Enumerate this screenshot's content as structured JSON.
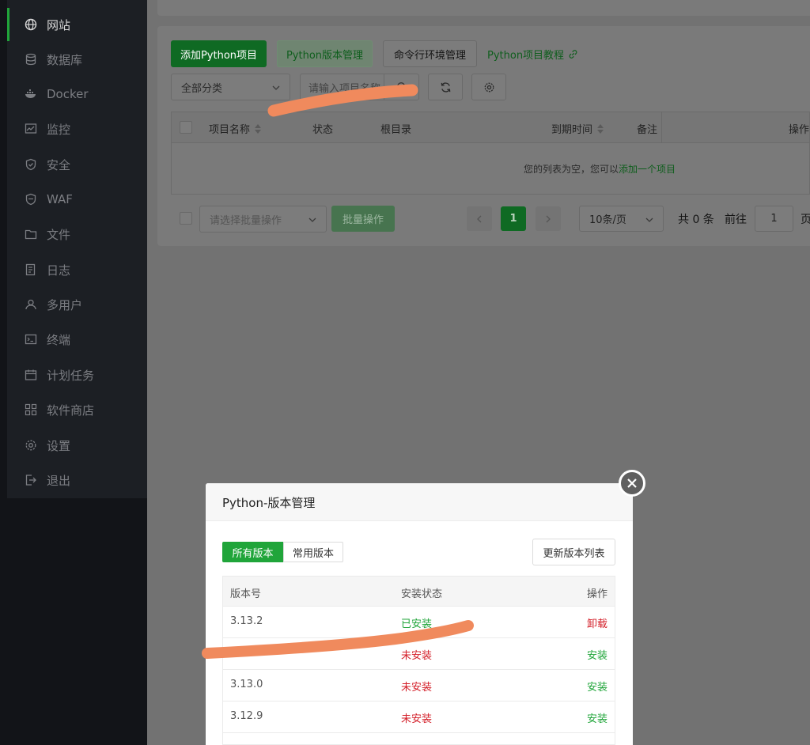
{
  "sidebar": {
    "items": [
      {
        "label": "网站",
        "icon": "globe-icon",
        "active": true
      },
      {
        "label": "数据库",
        "icon": "database-icon"
      },
      {
        "label": "Docker",
        "icon": "docker-icon"
      },
      {
        "label": "监控",
        "icon": "monitor-icon"
      },
      {
        "label": "安全",
        "icon": "shield-icon"
      },
      {
        "label": "WAF",
        "icon": "waf-shield-icon"
      },
      {
        "label": "文件",
        "icon": "folder-icon"
      },
      {
        "label": "日志",
        "icon": "log-icon"
      },
      {
        "label": "多用户",
        "icon": "users-icon"
      },
      {
        "label": "终端",
        "icon": "terminal-icon"
      },
      {
        "label": "计划任务",
        "icon": "calendar-icon"
      },
      {
        "label": "软件商店",
        "icon": "apps-icon"
      },
      {
        "label": "设置",
        "icon": "gear-icon"
      },
      {
        "label": "退出",
        "icon": "logout-icon"
      }
    ]
  },
  "toolbar": {
    "add_python_project": "添加Python项目",
    "python_version_manage": "Python版本管理",
    "cmd_env_manage": "命令行环境管理",
    "python_tutorial": "Python项目教程"
  },
  "filter": {
    "category_selected": "全部分类",
    "search_placeholder": "请输入项目名称"
  },
  "project_table": {
    "columns": [
      "项目名称",
      "状态",
      "根目录",
      "到期时间",
      "备注",
      "操作"
    ],
    "empty_text": "您的列表为空，您可以",
    "empty_link": "添加一个项目"
  },
  "batch": {
    "select_placeholder": "请选择批量操作",
    "button": "批量操作"
  },
  "pagination": {
    "current_page": "1",
    "page_size": "10条/页",
    "total_text": "共 0 条",
    "goto_text": "前往",
    "goto_value": "1",
    "page_suffix": "页"
  },
  "modal": {
    "title": "Python-版本管理",
    "tabs": [
      "所有版本",
      "常用版本"
    ],
    "refresh_button": "更新版本列表",
    "columns": [
      "版本号",
      "安装状态",
      "操作"
    ],
    "rows": [
      {
        "version": "3.13.2",
        "status": "已安装",
        "action": "卸载",
        "installed": true
      },
      {
        "version": "",
        "status": "未安装",
        "action": "安装",
        "installed": false
      },
      {
        "version": "3.13.0",
        "status": "未安装",
        "action": "安装",
        "installed": false
      },
      {
        "version": "3.12.9",
        "status": "未安装",
        "action": "安装",
        "installed": false
      }
    ]
  },
  "colors": {
    "accent": "#20a53a",
    "danger": "#d4202a",
    "annotation": "#f08a5d"
  }
}
